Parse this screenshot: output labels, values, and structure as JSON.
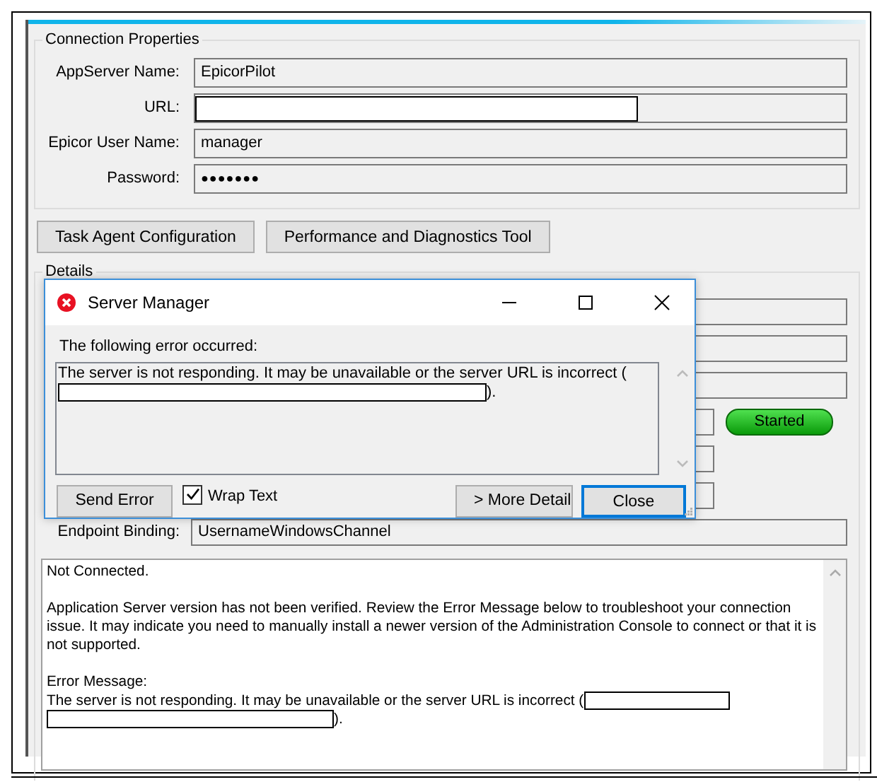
{
  "connection_properties": {
    "title": "Connection Properties",
    "fields": [
      {
        "label": "AppServer Name:",
        "kind": "text",
        "value": "EpicorPilot"
      },
      {
        "label": "URL:",
        "kind": "redacted"
      },
      {
        "label": "Epicor User Name:",
        "kind": "text",
        "value": "manager"
      },
      {
        "label": "Password:",
        "kind": "password",
        "value": "●●●●●●●"
      }
    ]
  },
  "buttons": [
    "Task Agent Configuration",
    "Performance and Diagnostics Tool"
  ],
  "details": {
    "title": "Details",
    "status": {
      "label": "Started"
    },
    "endpoint_binding": {
      "label": "Endpoint Binding:",
      "value": "UsernameWindowsChannel"
    }
  },
  "log": {
    "paragraphs": [
      "Not Connected.",
      "Application Server version has not been verified. Review the Error Message below to troubleshoot your connection issue. It may indicate you need to manually install a newer version of the Administration Console to connect or that it is not supported."
    ],
    "error_heading": "Error Message:",
    "error_segments": [
      {
        "kind": "text",
        "text": "The server is not responding. It may be unavailable or the server URL is incorrect ("
      },
      {
        "kind": "redacted"
      },
      {
        "kind": "redacted"
      },
      {
        "kind": "text",
        "text": ")."
      }
    ]
  },
  "dialog": {
    "title": "Server Manager",
    "prompt": "The following error occurred:",
    "message": [
      {
        "kind": "text",
        "text": "The server is not responding. It may be unavailable or the server URL is incorrect ("
      },
      {
        "kind": "redacted"
      },
      {
        "kind": "text",
        "text": ")."
      }
    ],
    "wrap_text": {
      "label": "Wrap Text",
      "checked": true
    },
    "buttons": [
      {
        "label": "Send Error",
        "default": false
      },
      {
        "label": "> More Detail",
        "default": false
      },
      {
        "label": "Close",
        "default": true
      }
    ]
  }
}
